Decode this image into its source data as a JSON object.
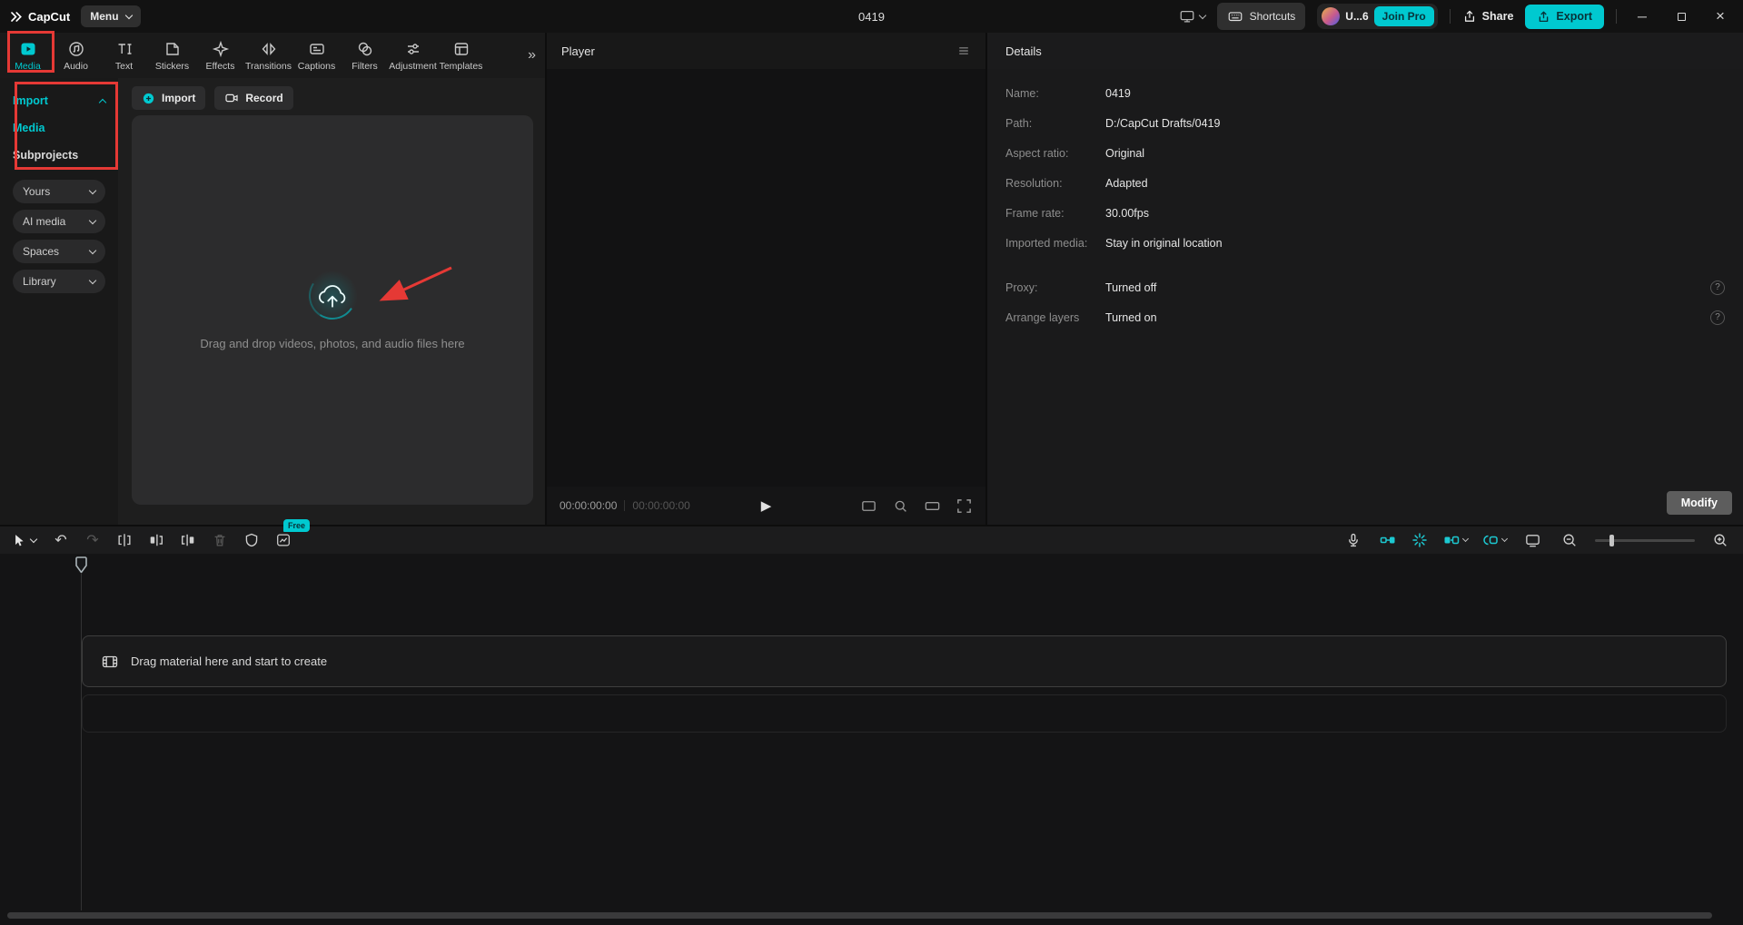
{
  "titlebar": {
    "app": "CapCut",
    "menu": "Menu",
    "title": "0419",
    "shortcuts": "Shortcuts",
    "user": "U...6",
    "join_pro": "Join Pro",
    "share": "Share",
    "export": "Export"
  },
  "tabs": [
    {
      "label": "Media"
    },
    {
      "label": "Audio"
    },
    {
      "label": "Text"
    },
    {
      "label": "Stickers"
    },
    {
      "label": "Effects"
    },
    {
      "label": "Transitions"
    },
    {
      "label": "Captions"
    },
    {
      "label": "Filters"
    },
    {
      "label": "Adjustment"
    },
    {
      "label": "Templates"
    }
  ],
  "tabs_more": "»",
  "sidebar": {
    "items": [
      {
        "label": "Import"
      },
      {
        "label": "Media"
      },
      {
        "label": "Subprojects"
      }
    ],
    "groups": [
      {
        "label": "Yours"
      },
      {
        "label": "AI media"
      },
      {
        "label": "Spaces"
      },
      {
        "label": "Library"
      }
    ]
  },
  "media_panel": {
    "import_button": "Import",
    "record_button": "Record",
    "dropzone_hint": "Drag and drop videos, photos, and audio files here"
  },
  "player": {
    "title": "Player",
    "time_current": "00:00:00:00",
    "time_total": "00:00:00:00"
  },
  "details": {
    "title": "Details",
    "rows": [
      {
        "label": "Name:",
        "value": "0419"
      },
      {
        "label": "Path:",
        "value": "D:/CapCut Drafts/0419"
      },
      {
        "label": "Aspect ratio:",
        "value": "Original"
      },
      {
        "label": "Resolution:",
        "value": "Adapted"
      },
      {
        "label": "Frame rate:",
        "value": "30.00fps"
      },
      {
        "label": "Imported media:",
        "value": "Stay in original location"
      },
      {
        "label": "Proxy:",
        "value": "Turned off"
      },
      {
        "label": "Arrange layers",
        "value": "Turned on"
      }
    ],
    "modify_button": "Modify"
  },
  "toolbar": {
    "free_badge": "Free"
  },
  "timeline": {
    "hint": "Drag material here and start to create"
  },
  "icons": {
    "undo": "↶",
    "redo": "↷",
    "play": "▶",
    "help": "?",
    "minimize": "─",
    "close": "×"
  },
  "colors": {
    "accent": "#00c9d0",
    "annotation_red": "#e53935"
  }
}
